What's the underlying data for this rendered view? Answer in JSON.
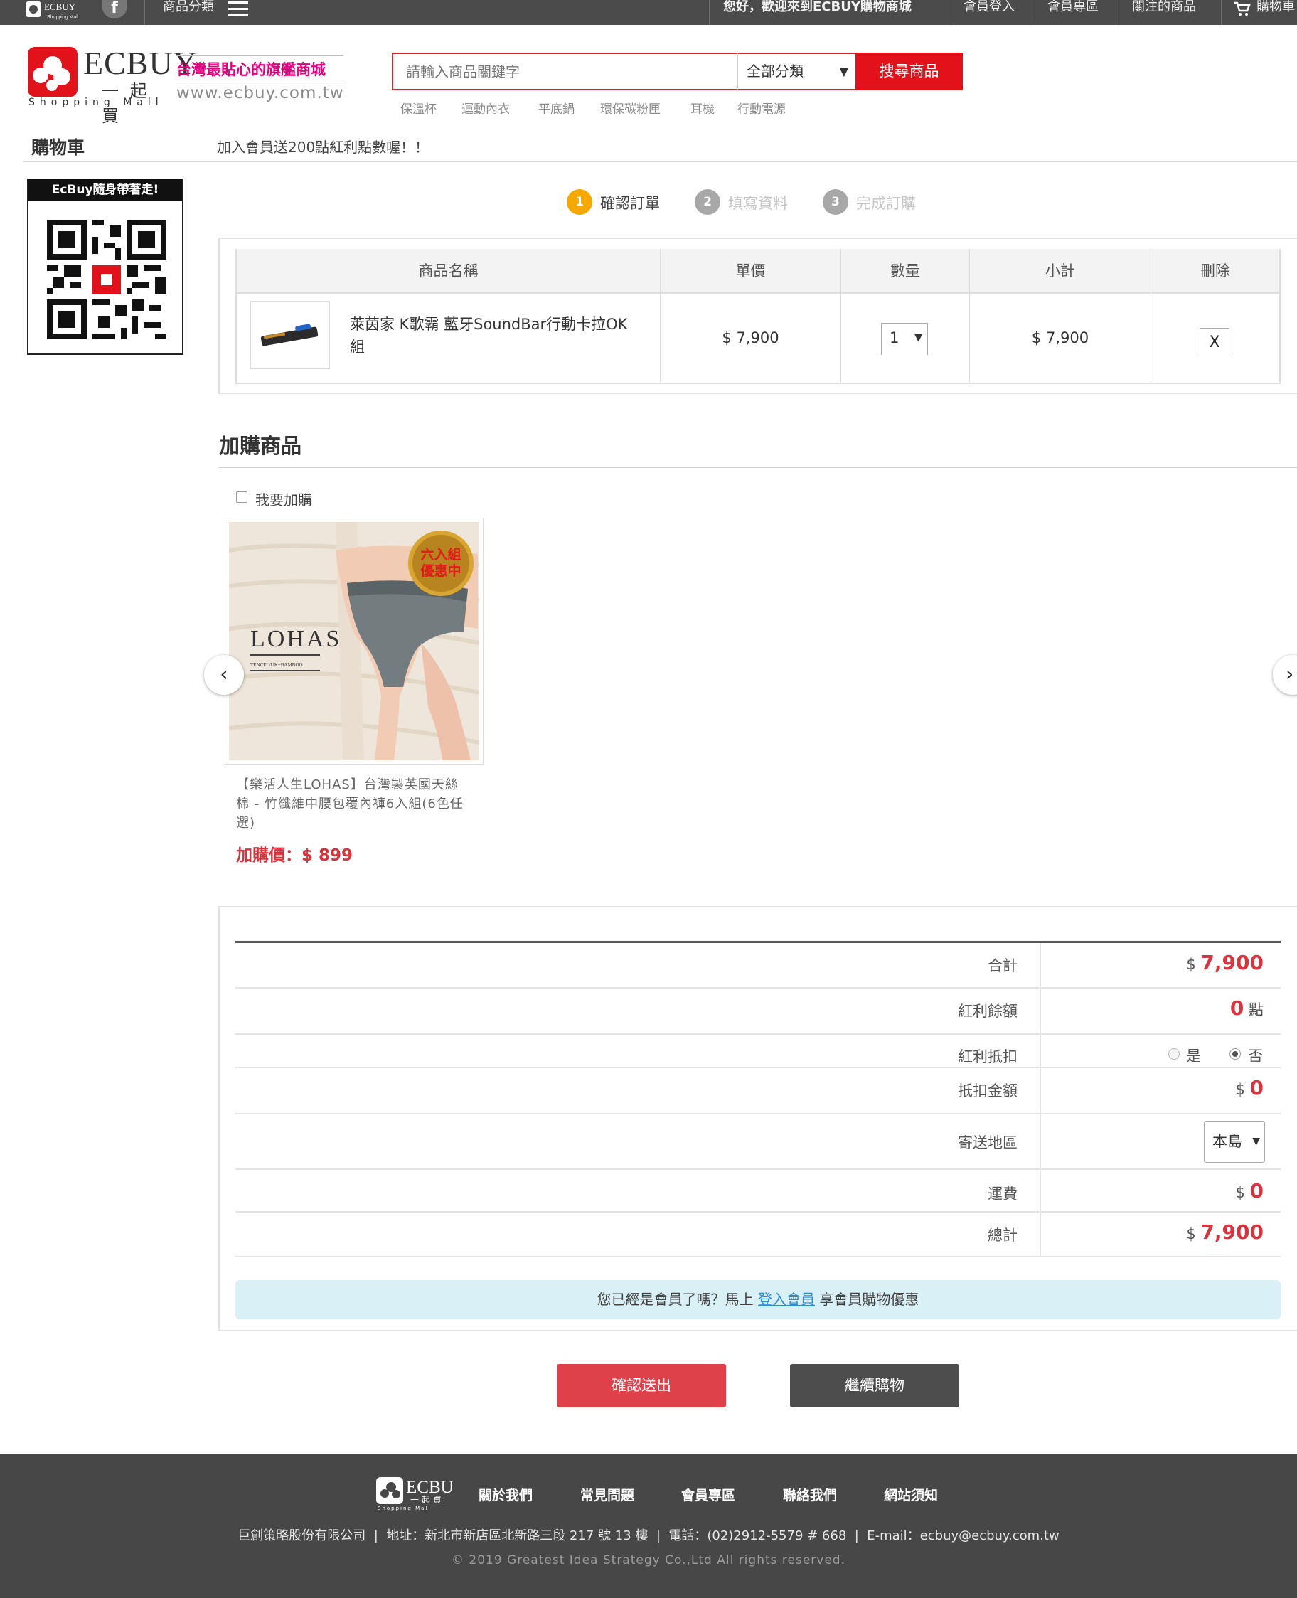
{
  "topbar": {
    "category_menu": "商品分類",
    "welcome": "您好，歡迎來到ECBUY購物商城",
    "links": [
      "會員登入",
      "會員專區",
      "關注的商品",
      "購物車"
    ]
  },
  "brand": {
    "logo_text": "ECBUY",
    "logo_sub": "一 起 買",
    "logo_tag": "Shopping Mall",
    "slogan": "台灣最貼心的旗艦商城",
    "url": "www.ecbuy.com.tw"
  },
  "search": {
    "placeholder": "請輸入商品關鍵字",
    "category": "全部分類",
    "button": "搜尋商品",
    "hot_keywords": [
      "保溫杯",
      "運動內衣",
      "平底鍋",
      "環保碳粉匣",
      "耳機",
      "行動電源"
    ]
  },
  "page": {
    "title": "購物車",
    "promo": "加入會員送200點紅利點數喔！！"
  },
  "sidebar": {
    "qr_title": "EcBuy隨身帶著走!"
  },
  "steps": [
    {
      "num": "1",
      "label": "確認訂單"
    },
    {
      "num": "2",
      "label": "填寫資料"
    },
    {
      "num": "3",
      "label": "完成訂購"
    }
  ],
  "cart": {
    "headers": [
      "商品名稱",
      "單價",
      "數量",
      "小計",
      "刪除"
    ],
    "item": {
      "name": "萊茵家 K歌霸 藍牙SoundBar行動卡拉OK組",
      "price": "$ 7,900",
      "qty": "1",
      "subtotal": "$ 7,900",
      "delete": "X"
    }
  },
  "addon": {
    "title": "加購商品",
    "checkbox_label": "我要加購",
    "product": {
      "name": "【樂活人生LOHAS】台灣製英國天絲棉 - 竹纖維中腰包覆內褲6入組(6色任選)",
      "price_label": "加購價：$ 899",
      "badge_line1": "六入組",
      "badge_line2": "優惠中",
      "brand": "LOHAS",
      "brand_sub": "TENCEL/UK+BAMBOO"
    }
  },
  "summary": {
    "rows": [
      {
        "label": "合計",
        "prefix": "$",
        "value": "7,900",
        "suffix": ""
      },
      {
        "label": "紅利餘額",
        "prefix": "",
        "value": "0",
        "suffix": "點"
      },
      {
        "label": "紅利抵扣",
        "yes": "是",
        "no": "否"
      },
      {
        "label": "抵扣金額",
        "prefix": "$",
        "value": "0",
        "suffix": ""
      },
      {
        "label": "寄送地區",
        "select": "本島"
      },
      {
        "label": "運費",
        "prefix": "$",
        "value": "0",
        "suffix": ""
      },
      {
        "label": "總計",
        "prefix": "$",
        "value": "7,900",
        "suffix": ""
      }
    ],
    "member_notice_before": "您已經是會員了嗎？馬上",
    "member_link": "登入會員",
    "member_notice_after": "享會員購物優惠"
  },
  "buttons": {
    "confirm": "確認送出",
    "continue": "繼續購物"
  },
  "footer": {
    "links": [
      "關於我們",
      "常見問題",
      "會員專區",
      "聯絡我們",
      "網站須知"
    ],
    "info": "巨創策略股份有限公司  |  地址：新北市新店區北新路三段 217 號 13 樓  |  電話：(02)2912-5579 # 668  |  E-mail：ecbuy@ecbuy.com.tw",
    "copyright": "© 2019 Greatest Idea Strategy Co.,Ltd All rights reserved."
  },
  "colors": {
    "accent_red": "#e2111a",
    "price_red": "#d9343d",
    "step_active": "#f5a800",
    "step_inactive": "#999999",
    "footer_bg": "#474747",
    "notice_bg": "#d9f0f6"
  }
}
